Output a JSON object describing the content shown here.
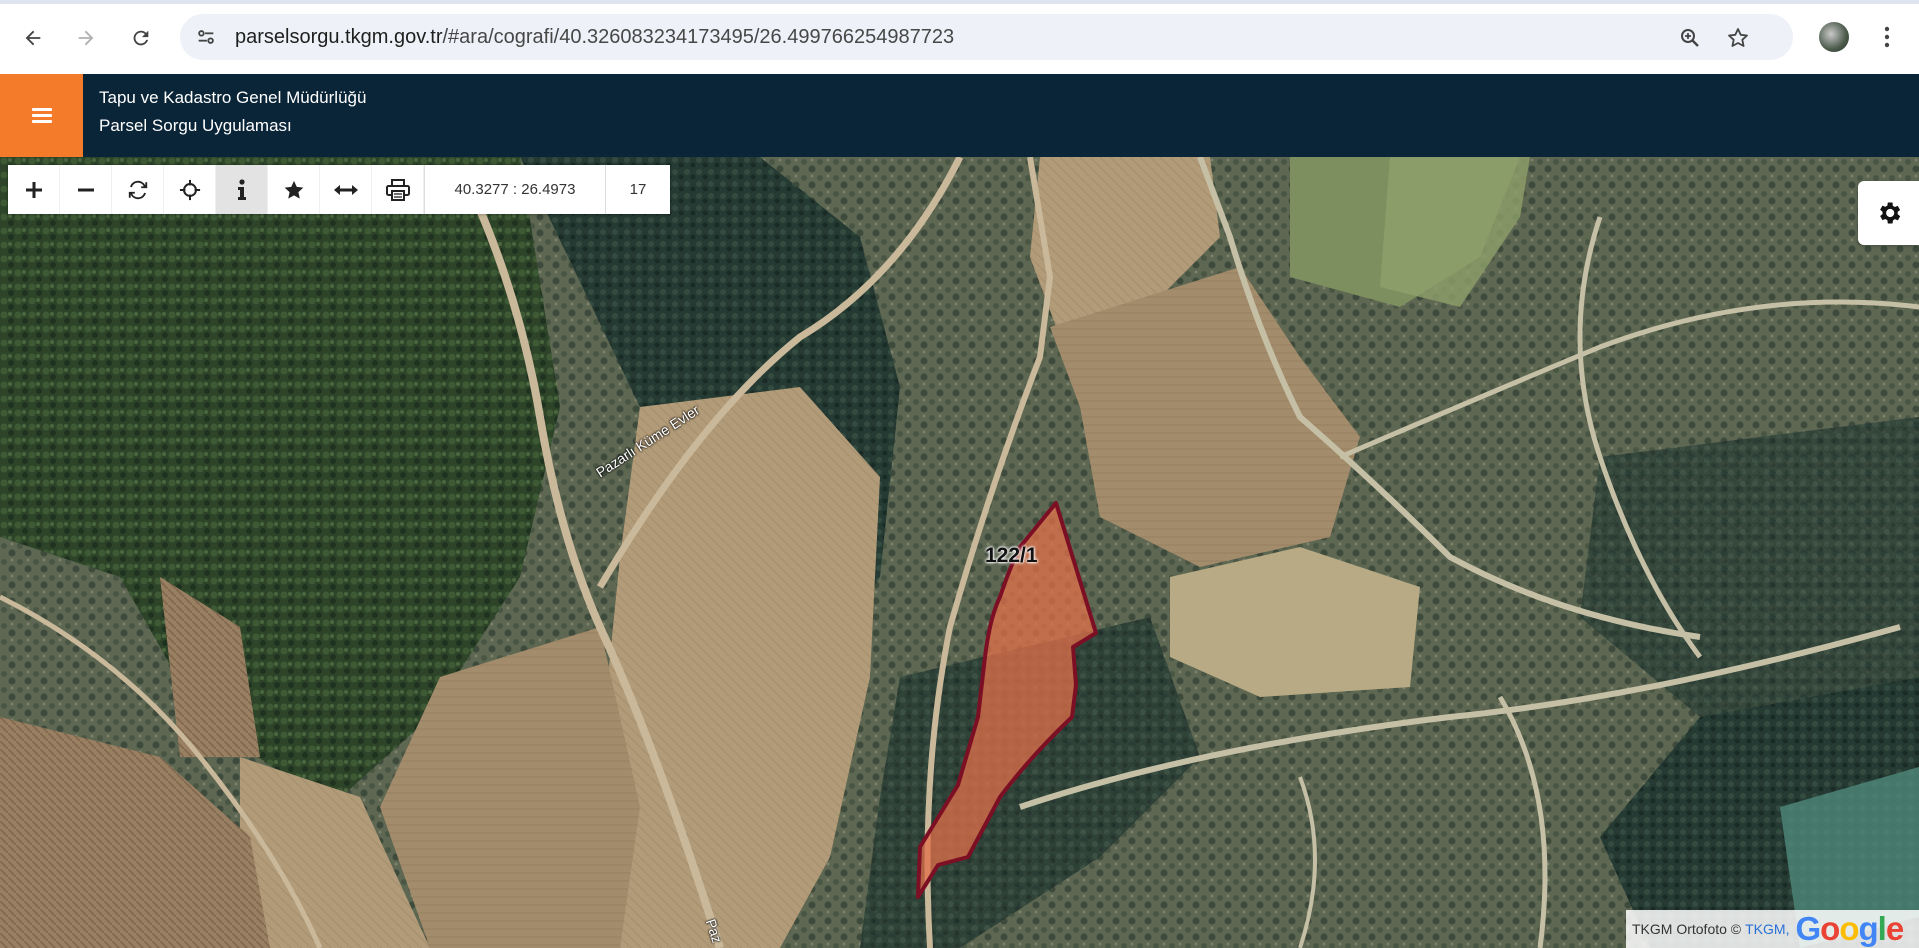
{
  "browser": {
    "url_domain": "parselsorgu.tkgm.gov.tr",
    "url_path": "/#ara/cografi/40.326083234173495/26.499766254987723",
    "icons": [
      "back-arrow-icon",
      "forward-arrow-icon",
      "reload-icon",
      "site-info-icon",
      "zoom-icon",
      "bookmark-star-icon",
      "profile-avatar",
      "more-vert-icon"
    ]
  },
  "header": {
    "org_title": "Tapu ve Kadastro Genel Müdürlüğü",
    "app_title": "Parsel Sorgu Uygulaması",
    "accent_color": "#f47b2a",
    "bg_color": "#0b2538"
  },
  "toolbar": {
    "tools": [
      "zoom-in",
      "zoom-out",
      "refresh",
      "locate",
      "info",
      "favorites",
      "measure",
      "print"
    ],
    "active_tool": "info",
    "coordinates": "40.3277 : 26.4973",
    "zoom_level": "17"
  },
  "map": {
    "parcel_label": "122/1",
    "parcel_fill": "#e1704a",
    "parcel_stroke": "#7d0f24",
    "road_label_1": "Pazarlı Küme Evler",
    "road_label_2": "Paz"
  },
  "attribution": {
    "text": "TKGM Ortofoto ©",
    "link": "TKGM,",
    "logo": "Google"
  }
}
